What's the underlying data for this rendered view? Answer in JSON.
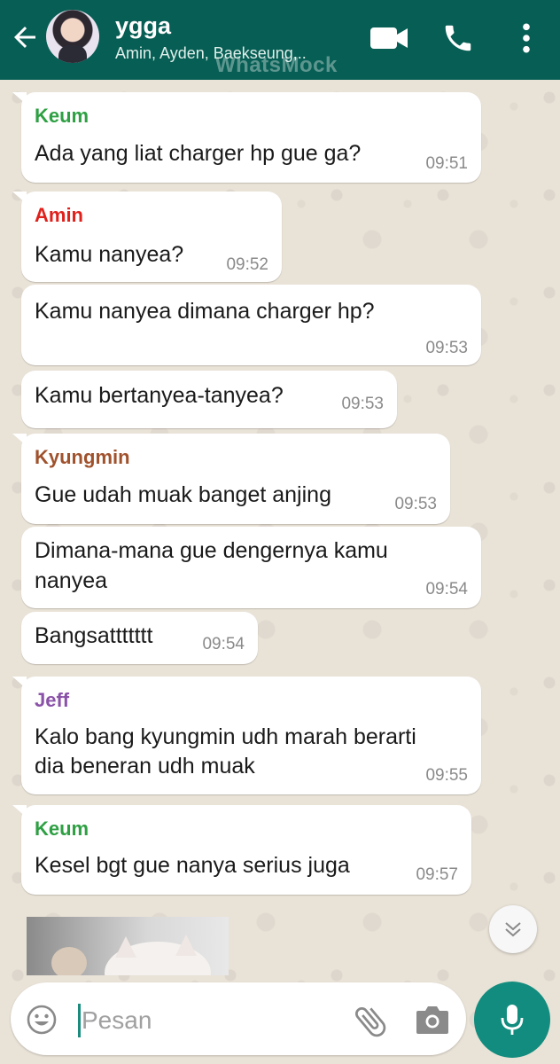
{
  "header": {
    "title": "ygga",
    "subtitle": "Amin, Ayden, Baekseung,..",
    "watermark": "WhatsMock",
    "icons": [
      "back-arrow-icon",
      "video-call-icon",
      "voice-call-icon",
      "more-options-icon"
    ]
  },
  "messages": [
    {
      "sender": "Keum",
      "sender_color": "#2ea043",
      "lines": [
        "Ada yang liat charger hp gue ga?"
      ],
      "time": "09:51"
    },
    {
      "sender": "Amin",
      "sender_color": "#e0201b",
      "lines": [
        "Kamu nanyea?"
      ],
      "time": "09:52"
    },
    {
      "sender": "",
      "lines": [
        "Kamu nanyea dimana charger hp?"
      ],
      "time": "09:53"
    },
    {
      "sender": "",
      "lines": [
        "Kamu bertanyea-tanyea?"
      ],
      "time": "09:53"
    },
    {
      "sender": "Kyungmin",
      "sender_color": "#a0522d",
      "lines": [
        "Gue udah muak banget anjing"
      ],
      "time": "09:53"
    },
    {
      "sender": "",
      "lines": [
        "Dimana-mana gue dengernya kamu",
        "nanyea"
      ],
      "time": "09:54"
    },
    {
      "sender": "",
      "lines": [
        "Bangsattttttt"
      ],
      "time": "09:54"
    },
    {
      "sender": "Jeff",
      "sender_color": "#8a52a8",
      "lines": [
        "Kalo bang kyungmin udh marah berarti",
        "dia beneran udh muak"
      ],
      "time": "09:55"
    },
    {
      "sender": "Keum",
      "sender_color": "#2ea043",
      "lines": [
        "Kesel bgt gue nanya serius juga"
      ],
      "time": "09:57"
    }
  ],
  "input": {
    "placeholder": "Pesan",
    "icons": [
      "emoji-icon",
      "attach-icon",
      "camera-icon",
      "mic-icon"
    ]
  },
  "colors": {
    "header_bg": "#075e54",
    "accent": "#128c7e",
    "bubble_bg": "#ffffff"
  }
}
